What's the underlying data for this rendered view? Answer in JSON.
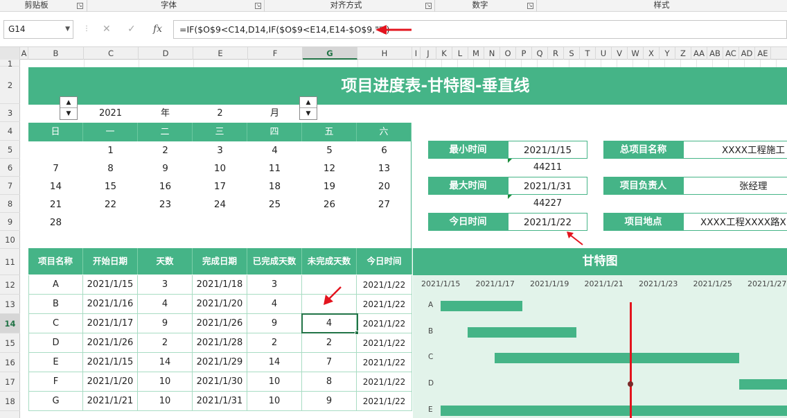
{
  "ribbon": {
    "groups": [
      "剪贴板",
      "字体",
      "对齐方式",
      "数字",
      "样式"
    ]
  },
  "formula_bar": {
    "name_box": "G14",
    "formula": "=IF($O$9<C14,D14,IF($O$9<E14,E14-$O$9,\"\"))",
    "cancel_icon": "✕",
    "enter_icon": "✓",
    "fx_icon": "fx"
  },
  "columns": [
    "A",
    "B",
    "C",
    "D",
    "E",
    "F",
    "G",
    "H",
    "I",
    "J",
    "K",
    "L",
    "M",
    "N",
    "O",
    "P",
    "Q",
    "R",
    "S",
    "T",
    "U",
    "V",
    "W",
    "X",
    "Y",
    "Z",
    "AA",
    "AB",
    "AC",
    "AD",
    "AE"
  ],
  "rows": [
    "1",
    "2",
    "3",
    "4",
    "5",
    "6",
    "7",
    "8",
    "9",
    "10",
    "11",
    "12",
    "13",
    "14",
    "15",
    "16",
    "17",
    "18"
  ],
  "title": "项目进度表-甘特图-垂直线",
  "year_month": {
    "year": "2021",
    "year_label": "年",
    "month": "2",
    "month_label": "月"
  },
  "calendar": {
    "weekdays": [
      "日",
      "一",
      "二",
      "三",
      "四",
      "五",
      "六"
    ],
    "weeks": [
      [
        "",
        "1",
        "2",
        "3",
        "4",
        "5",
        "6"
      ],
      [
        "7",
        "8",
        "9",
        "10",
        "11",
        "12",
        "13"
      ],
      [
        "14",
        "15",
        "16",
        "17",
        "18",
        "19",
        "20"
      ],
      [
        "21",
        "22",
        "23",
        "24",
        "25",
        "26",
        "27"
      ],
      [
        "28",
        "",
        "",
        "",
        "",
        "",
        ""
      ]
    ]
  },
  "info": {
    "min_label": "最小时间",
    "min_value": "2021/1/15",
    "min_serial": "44211",
    "max_label": "最大时间",
    "max_value": "2021/1/31",
    "max_serial": "44227",
    "today_label": "今日时间",
    "today_value": "2021/1/22",
    "proj_name_label": "总项目名称",
    "proj_name_value": "XXXX工程施工",
    "manager_label": "项目负责人",
    "manager_value": "张经理",
    "location_label": "项目地点",
    "location_value": "XXXX工程XXXX路X"
  },
  "table": {
    "headers": [
      "项目名称",
      "开始日期",
      "天数",
      "完成日期",
      "已完成天数",
      "未完成天数",
      "今日时间"
    ],
    "rows": [
      [
        "A",
        "2021/1/15",
        "3",
        "2021/1/18",
        "3",
        "",
        "2021/1/22"
      ],
      [
        "B",
        "2021/1/16",
        "4",
        "2021/1/20",
        "4",
        "",
        "2021/1/22"
      ],
      [
        "C",
        "2021/1/17",
        "9",
        "2021/1/26",
        "9",
        "4",
        "2021/1/22"
      ],
      [
        "D",
        "2021/1/26",
        "2",
        "2021/1/28",
        "2",
        "2",
        "2021/1/22"
      ],
      [
        "E",
        "2021/1/15",
        "14",
        "2021/1/29",
        "14",
        "7",
        "2021/1/22"
      ],
      [
        "F",
        "2021/1/20",
        "10",
        "2021/1/30",
        "10",
        "8",
        "2021/1/22"
      ],
      [
        "G",
        "2021/1/21",
        "10",
        "2021/1/31",
        "10",
        "9",
        "2021/1/22"
      ]
    ]
  },
  "gantt": {
    "title": "甘特图",
    "ticks": [
      "2021/1/15",
      "2021/1/17",
      "2021/1/19",
      "2021/1/21",
      "2021/1/23",
      "2021/1/25",
      "2021/1/27"
    ],
    "bars": [
      {
        "name": "A",
        "start": "2021/1/15",
        "days": 3
      },
      {
        "name": "B",
        "start": "2021/1/16",
        "days": 4
      },
      {
        "name": "C",
        "start": "2021/1/17",
        "days": 9
      },
      {
        "name": "D",
        "start": "2021/1/26",
        "days": 2
      },
      {
        "name": "E",
        "start": "2021/1/15",
        "days": 14
      }
    ],
    "today": "2021/1/22",
    "bar_color": "#45b487",
    "line_color": "#e3141e"
  },
  "colors": {
    "accent": "#45b487",
    "annotation_arrow": "#e3141e"
  }
}
